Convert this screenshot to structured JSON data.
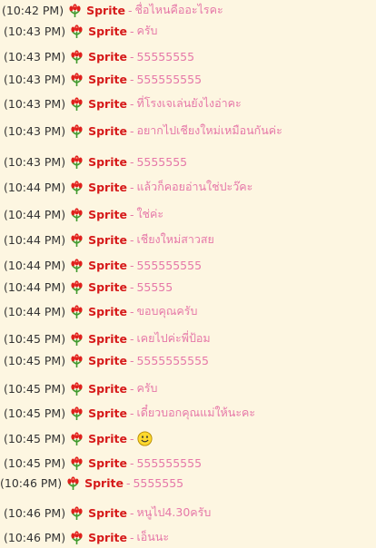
{
  "user_name": "Sprite",
  "separator": "-",
  "messages": [
    {
      "time": "(10:42 PM)",
      "text": "ชื่อไหนคืออะไรคะ",
      "emoticon": ""
    },
    {
      "time": "(10:43 PM)",
      "text": "ครับ",
      "emoticon": ""
    },
    {
      "time": "(10:43 PM)",
      "text": "55555555",
      "emoticon": ""
    },
    {
      "time": "(10:43 PM)",
      "text": "555555555",
      "emoticon": ""
    },
    {
      "time": "(10:43 PM)",
      "text": "ที่โรงเจเล่นยังไงอ่าคะ",
      "emoticon": ""
    },
    {
      "time": "(10:43 PM)",
      "text": "อยากไปเชียงใหม่เหมือนกันค่ะ",
      "emoticon": ""
    },
    {
      "time": "(10:43 PM)",
      "text": "5555555",
      "emoticon": ""
    },
    {
      "time": "(10:44 PM)",
      "text": "แล้วก็คอยอ่านใช่ปะว๊คะ",
      "emoticon": ""
    },
    {
      "time": "(10:44 PM)",
      "text": "ใช่ค่ะ",
      "emoticon": ""
    },
    {
      "time": "(10:44 PM)",
      "text": "เชียงใหม่สาวสย",
      "emoticon": ""
    },
    {
      "time": "(10:44 PM)",
      "text": "555555555",
      "emoticon": ""
    },
    {
      "time": "(10:44 PM)",
      "text": "55555",
      "emoticon": ""
    },
    {
      "time": "(10:44 PM)",
      "text": "ขอบคุณครับ",
      "emoticon": ""
    },
    {
      "time": "(10:45 PM)",
      "text": "เคยไปค่ะพี่ป้อม",
      "emoticon": ""
    },
    {
      "time": "(10:45 PM)",
      "text": "5555555555",
      "emoticon": ""
    },
    {
      "time": "(10:45 PM)",
      "text": "ครับ",
      "emoticon": ""
    },
    {
      "time": "(10:45 PM)",
      "text": "เดี๋ยวบอกคุณแม่ให้นะคะ",
      "emoticon": ""
    },
    {
      "time": "(10:45 PM)",
      "text": "",
      "emoticon": "smiley-icon"
    },
    {
      "time": "(10:45 PM)",
      "text": "555555555",
      "emoticon": ""
    },
    {
      "time": "(10:46 PM)",
      "text": "5555555",
      "emoticon": ""
    },
    {
      "time": "(10:46 PM)",
      "text": "หนูไป4.30ครับ",
      "emoticon": ""
    },
    {
      "time": "(10:46 PM)",
      "text": "เอ็นนะ",
      "emoticon": ""
    }
  ]
}
